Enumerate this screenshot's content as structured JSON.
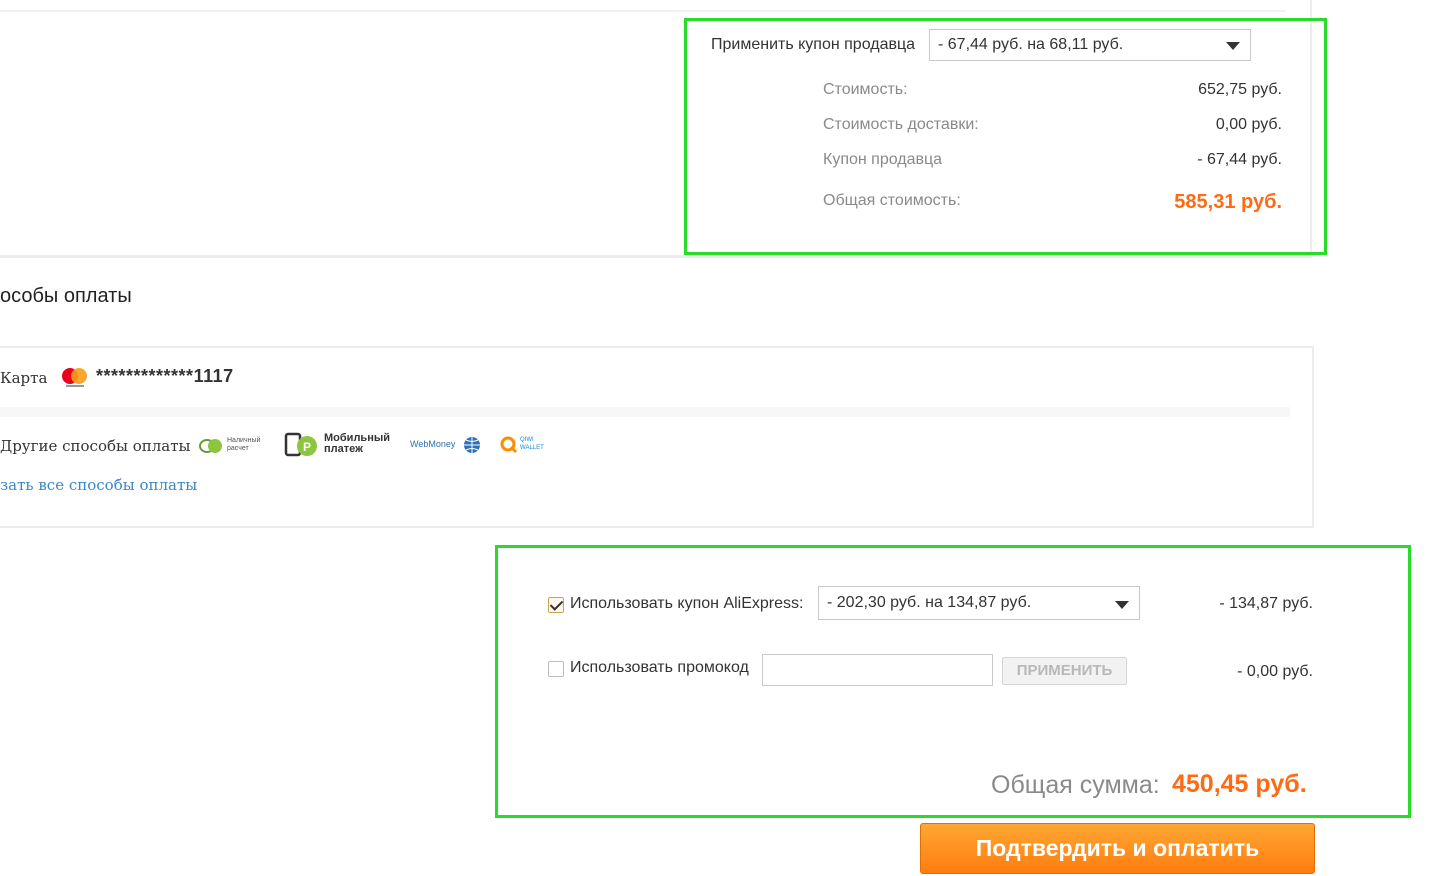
{
  "seller": {
    "coupon_label": "Применить купон продавца",
    "coupon_selected": "- 67,44 руб. на 68,11 руб.",
    "rows": [
      {
        "label": "Стоимость:",
        "value": "652,75 руб."
      },
      {
        "label": "Стоимость доставки:",
        "value": "0,00 руб."
      },
      {
        "label": "Купон продавца",
        "value": "- 67,44 руб."
      }
    ],
    "total_label": "Общая стоимость:",
    "total_value": "585,31 руб."
  },
  "payment": {
    "title": "особы оплаты",
    "card_label": "Карта",
    "card_number": "*************1117",
    "other_label": "Другие способы оплаты",
    "methods": {
      "cash": "Наличный расчет",
      "mobile": "Мобильный платеж",
      "webmoney": "WebMoney",
      "qiwi": "QIWI WALLET"
    },
    "show_all_link": "зать все способы оплаты"
  },
  "discounts": {
    "aliexpress_coupon": {
      "checked": true,
      "label": "Использовать купон AliExpress:",
      "selected": "- 202,30 руб. на 134,87 руб.",
      "amount": "- 134,87 руб."
    },
    "promo": {
      "checked": false,
      "label": "Использовать промокод",
      "placeholder": "",
      "apply_label": "ПРИМЕНИТЬ",
      "amount": "- 0,00 руб."
    },
    "total_label": "Общая сумма:",
    "total_value": "450,45 руб."
  },
  "confirm_label": "Подтвердить и оплатить",
  "colors": {
    "accent": "#ff6a14",
    "highlight": "#2bdb2b",
    "button": "#ff8a1f"
  }
}
